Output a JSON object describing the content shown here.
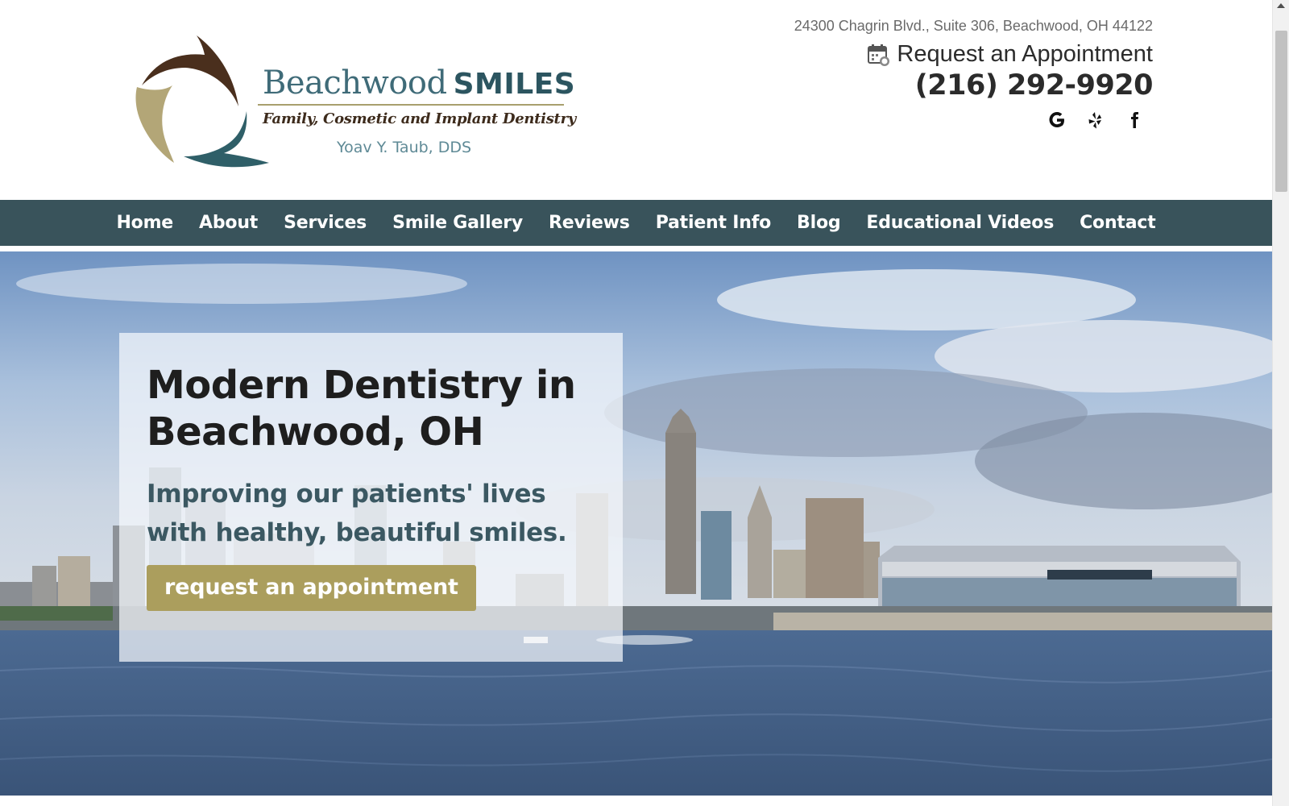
{
  "logo": {
    "name_serif": "Beachwood",
    "name_bold": "SMILES",
    "tagline": "Family, Cosmetic and Implant Dentistry",
    "doctor": "Yoav Y. Taub, DDS"
  },
  "contact": {
    "address": "24300 Chagrin Blvd., Suite 306, Beachwood, OH 44122",
    "appointment_link": "Request an Appointment",
    "phone": "(216) 292-9920",
    "social": [
      "google-icon",
      "yelp-icon",
      "facebook-icon"
    ]
  },
  "nav": {
    "items": [
      "Home",
      "About",
      "Services",
      "Smile Gallery",
      "Reviews",
      "Patient Info",
      "Blog",
      "Educational Videos",
      "Contact"
    ]
  },
  "hero": {
    "title": "Modern Dentistry in Beachwood, OH",
    "subtitle": "Improving our patients' lives with healthy, beautiful smiles.",
    "button": "request an appointment"
  },
  "colors": {
    "nav_bg": "#39535b",
    "accent_gold": "#ab9e5d",
    "brand_teal": "#2c5560",
    "subtitle_teal": "#3b5862"
  }
}
